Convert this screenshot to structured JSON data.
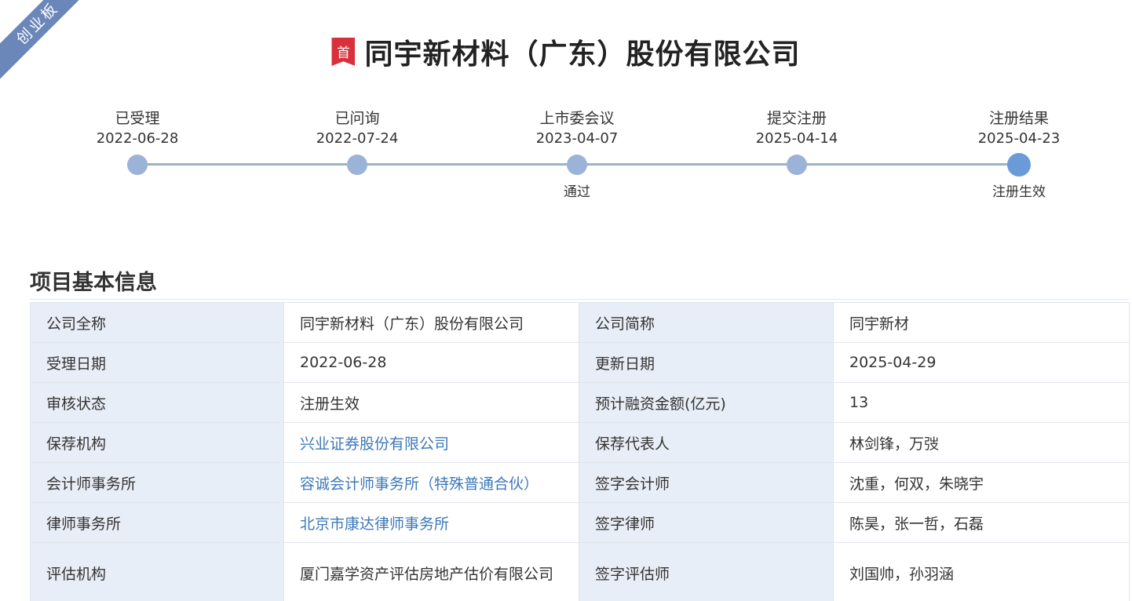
{
  "board_tag": "创业板",
  "title": {
    "badge": "首",
    "company": "同宇新材料（广东）股份有限公司"
  },
  "timeline": {
    "steps": [
      {
        "label": "已受理",
        "date": "2022-06-28",
        "result": ""
      },
      {
        "label": "已问询",
        "date": "2022-07-24",
        "result": ""
      },
      {
        "label": "上市委会议",
        "date": "2023-04-07",
        "result": "通过"
      },
      {
        "label": "提交注册",
        "date": "2025-04-14",
        "result": ""
      },
      {
        "label": "注册结果",
        "date": "2025-04-23",
        "result": "注册生效"
      }
    ]
  },
  "section": {
    "title": "项目基本信息"
  },
  "info_table": {
    "rows": [
      {
        "k1": "公司全称",
        "v1": "同宇新材料（广东）股份有限公司",
        "k2": "公司简称",
        "v2": "同宇新材"
      },
      {
        "k1": "受理日期",
        "v1": "2022-06-28",
        "k2": "更新日期",
        "v2": "2025-04-29"
      },
      {
        "k1": "审核状态",
        "v1": "注册生效",
        "k2": "预计融资金额(亿元)",
        "v2": "13"
      },
      {
        "k1": "保荐机构",
        "v1": "兴业证券股份有限公司",
        "k2": "保荐代表人",
        "v2": "林剑锋，万弢"
      },
      {
        "k1": "会计师事务所",
        "v1": "容诚会计师事务所（特殊普通合伙）",
        "k2": "签字会计师",
        "v2": "沈重，何双，朱晓宇"
      },
      {
        "k1": "律师事务所",
        "v1": "北京市康达律师事务所",
        "k2": "签字律师",
        "v2": "陈昊，张一哲，石磊"
      },
      {
        "k1": "评估机构",
        "v1": "厦门嘉学资产评估房地产估价有限公司",
        "k2": "签字评估师",
        "v2": "刘国帅，孙羽涵"
      }
    ]
  },
  "colors": {
    "ribbon": "#6b86b8",
    "badge": "#d8313b",
    "link": "#3d78b8",
    "key_cell_bg": "#e8eef7",
    "timeline_line": "#9ab3c9",
    "dot": "#9ab3d6",
    "dot_active": "#6a9ad8"
  }
}
